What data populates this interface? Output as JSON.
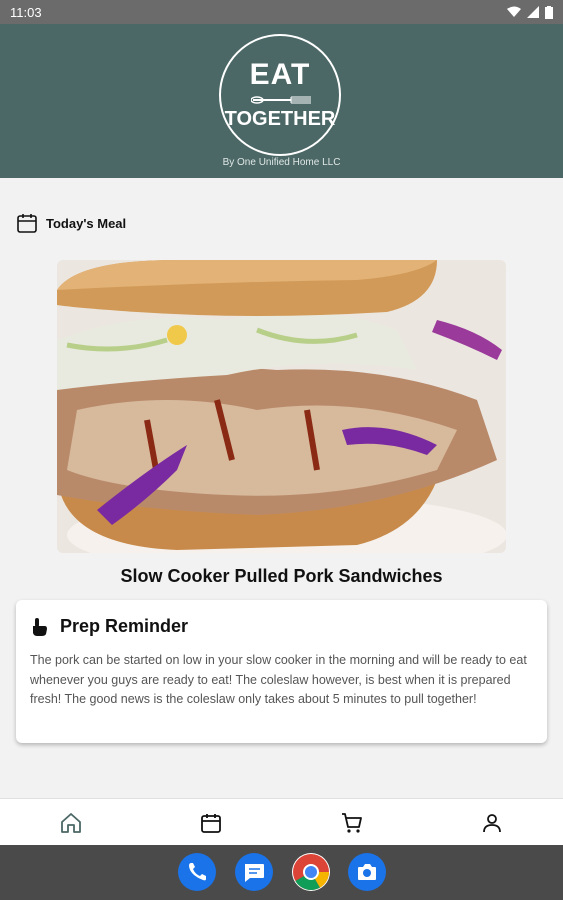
{
  "status_bar": {
    "time": "11:03"
  },
  "header": {
    "logo_line1": "EAT",
    "logo_line2": "TOGETHER",
    "byline": "By One Unified Home LLC"
  },
  "section": {
    "label": "Today's Meal"
  },
  "meal": {
    "title": "Slow Cooker Pulled Pork Sandwiches"
  },
  "reminder": {
    "title": "Prep Reminder",
    "body": "The pork can be started on low in your slow cooker in the morning and will be ready to eat whenever you guys are ready to eat! The coleslaw however, is best when it is prepared fresh! The good news is the coleslaw only takes about 5 minutes to pull together!"
  },
  "bottom_nav": {
    "items": [
      {
        "icon": "home-icon",
        "active": true
      },
      {
        "icon": "calendar-icon"
      },
      {
        "icon": "cart-icon"
      },
      {
        "icon": "profile-icon"
      }
    ]
  },
  "dock": {
    "apps": [
      "phone-icon",
      "messages-icon",
      "chrome-icon",
      "camera-icon"
    ]
  },
  "colors": {
    "header": "#4b6866",
    "background": "#f2f2f2",
    "card": "#ffffff"
  }
}
